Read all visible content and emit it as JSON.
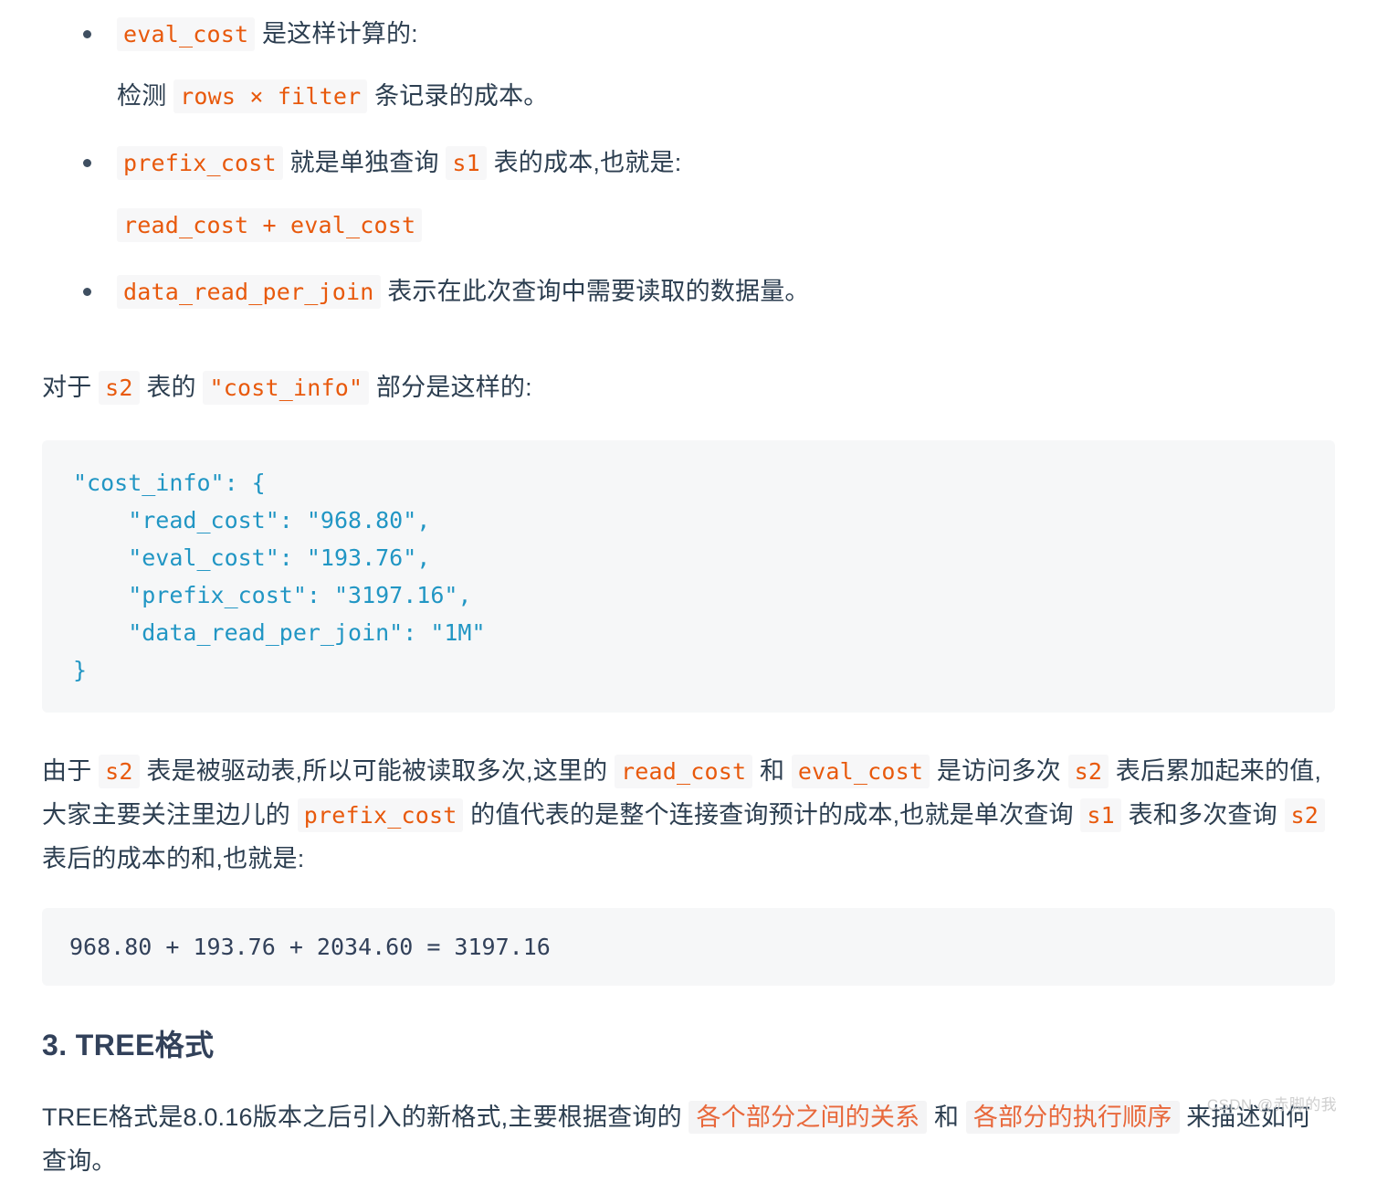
{
  "document": {
    "body_text_color": "#2c3e50",
    "inline_code_color": "#e8590c",
    "inline_code_bg": "#f7f7f8",
    "codeblock_bg": "#f6f7f8",
    "codeblock_text_color": "#2196c4",
    "heading_color": "#32415a",
    "highlight_phrase_color": "#e8683b"
  },
  "bullets": [
    {
      "code": "eval_cost",
      "text": " 是这样计算的:",
      "sub": {
        "prefix": "检测 ",
        "code": "rows × filter",
        "suffix": " 条记录的成本。"
      }
    },
    {
      "code": "prefix_cost",
      "text_before_s1": " 就是单独查询 ",
      "code_s1": "s1",
      "text_after_s1": " 表的成本,也就是:",
      "sub": {
        "code": "read_cost + eval_cost"
      }
    },
    {
      "code": "data_read_per_join",
      "text": " 表示在此次查询中需要读取的数据量。"
    }
  ],
  "intro_paragraph": {
    "p1": "对于 ",
    "code_s2": "s2",
    "p2": " 表的 ",
    "code_cost_info": "\"cost_info\"",
    "p3": " 部分是这样的:"
  },
  "cost_info_block": "\"cost_info\": {\n    \"read_cost\": \"968.80\",\n    \"eval_cost\": \"193.76\",\n    \"prefix_cost\": \"3197.16\",\n    \"data_read_per_join\": \"1M\"\n}",
  "cost_info_values": {
    "read_cost": "968.80",
    "eval_cost": "193.76",
    "prefix_cost": "3197.16",
    "data_read_per_join": "1M"
  },
  "explanation_paragraph": {
    "s1": "由于 ",
    "c1": "s2",
    "s2": " 表是被驱动表,所以可能被读取多次,这里的 ",
    "c2": "read_cost",
    "s3": " 和 ",
    "c3": "eval_cost",
    "s4": " 是访问多次 ",
    "c4": "s2",
    "s5": " 表后累加起来的值,大家主要关注里边儿的 ",
    "c5": "prefix_cost",
    "s6": " 的值代表的是整个连接查询预计的成本,也就是单次查询 ",
    "c6": "s1",
    "s7": " 表和多次查询 ",
    "c7": "s2",
    "s8": " 表后的成本的和,也就是:"
  },
  "formula_block": "968.80 + 193.76 + 2034.60 = 3197.16",
  "heading": "3. TREE格式",
  "tree_paragraph": {
    "t1": "TREE格式是8.0.16版本之后引入的新格式,主要根据查询的 ",
    "h1": "各个部分之间的关系",
    "t2": " 和 ",
    "h2": "各部分的执行顺序",
    "t3": " 来描述如何查询。"
  },
  "watermark": "CSDN @赤脚的我"
}
